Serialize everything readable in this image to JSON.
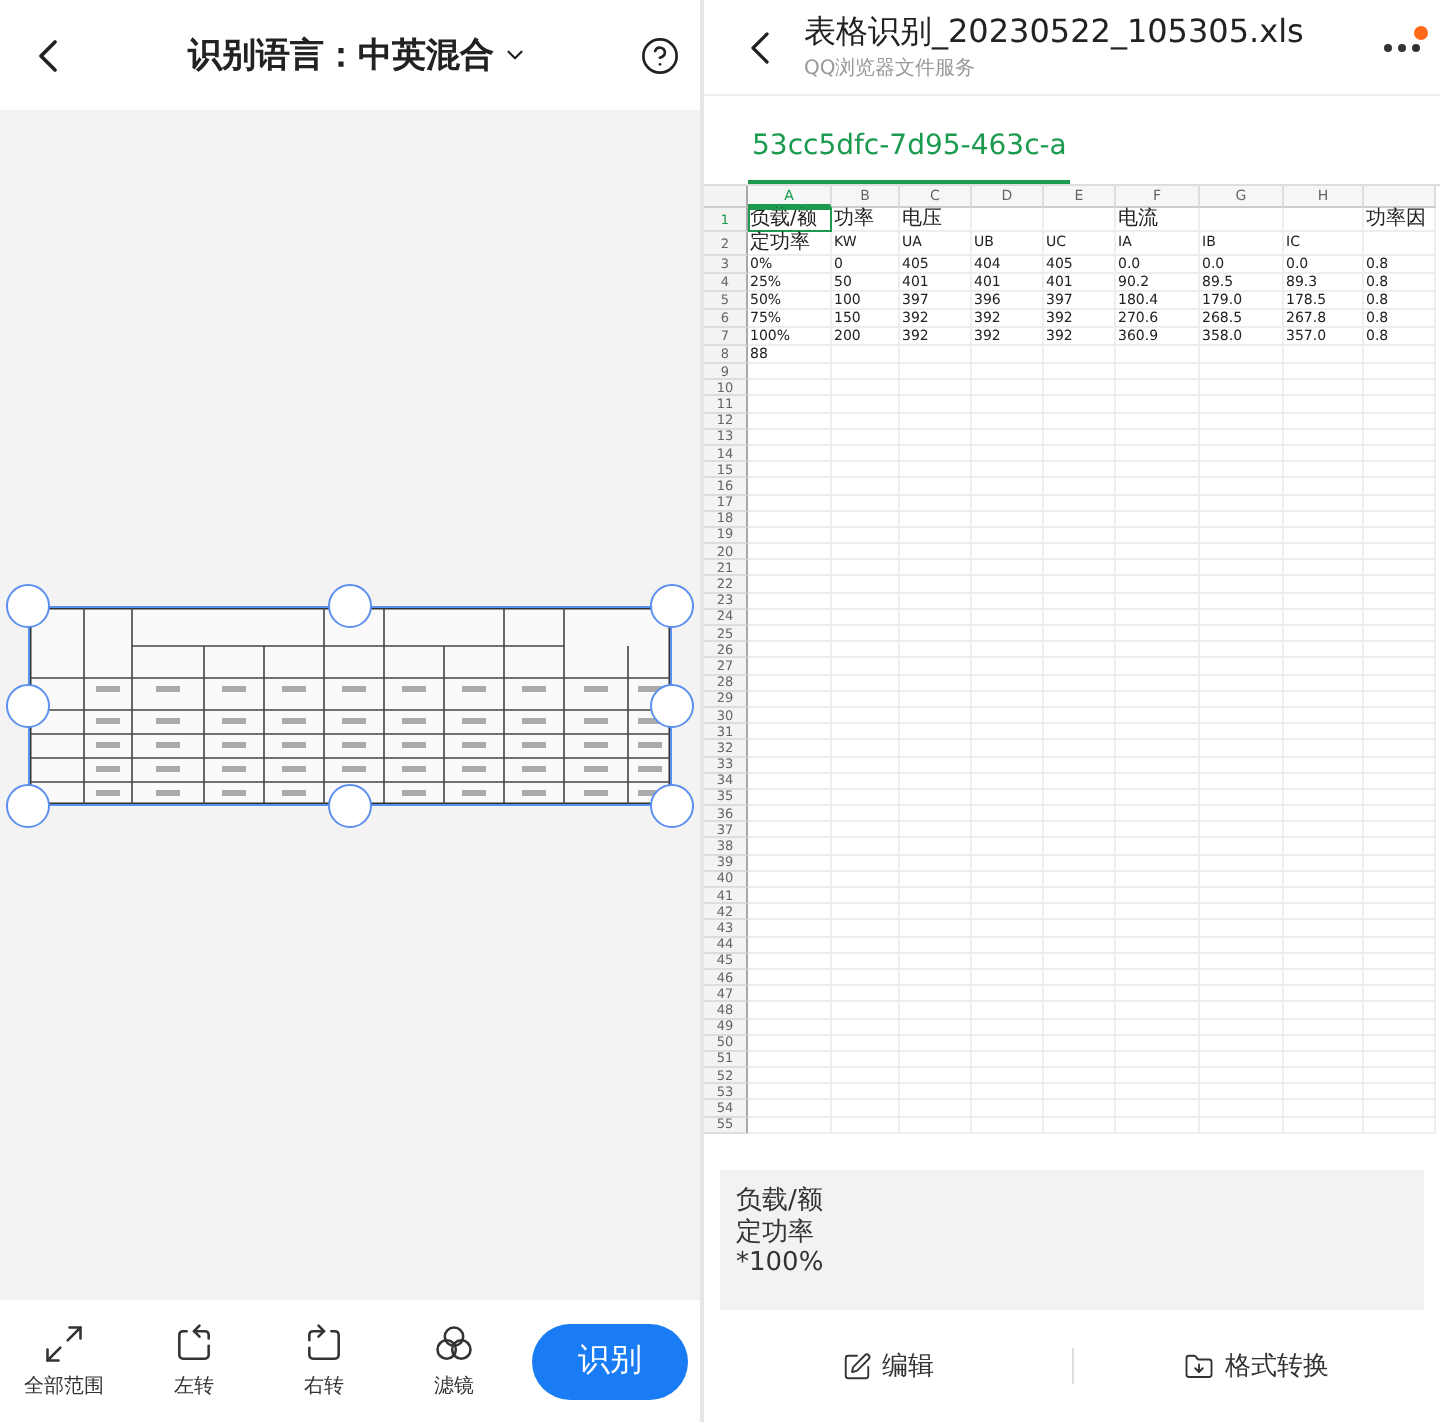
{
  "scan_screen": {
    "title": "识别语言：中英混合",
    "tools": [
      {
        "kind": "full",
        "label": "全部范围"
      },
      {
        "kind": "rotate_left",
        "label": "左转"
      },
      {
        "kind": "rotate_right",
        "label": "右转"
      },
      {
        "kind": "filter",
        "label": "滤镜"
      }
    ],
    "recognize_button": "识别"
  },
  "file_screen": {
    "title": "表格识别_20230522_105305.xls",
    "subtitle": "QQ浏览器文件服务",
    "has_notification": true,
    "sheet_tabs": [
      {
        "label": "53cc5dfc-7d95-463c-a",
        "selected": true
      }
    ],
    "sheet": {
      "columns": [
        {
          "label": "A",
          "selected": true
        },
        {
          "label": "B",
          "selected": false
        },
        {
          "label": "C",
          "selected": false
        },
        {
          "label": "D",
          "selected": false
        },
        {
          "label": "E",
          "selected": false
        },
        {
          "label": "F",
          "selected": false
        },
        {
          "label": "G",
          "selected": false
        },
        {
          "label": "H",
          "selected": false
        },
        {
          "selected": false
        }
      ],
      "rows": [
        {
          "number": "1",
          "selected": true,
          "cells": [
            "负载/额",
            "功率",
            "电压",
            null,
            null,
            "电流",
            null,
            null,
            "功率因"
          ]
        },
        {
          "number": "2",
          "selected": false,
          "cells": [
            "定功率",
            "KW",
            "UA",
            "UB",
            "UC",
            "IA",
            "IB",
            "IC",
            null
          ]
        },
        {
          "number": "3",
          "selected": false,
          "cells": [
            "0%",
            "0",
            "405",
            "404",
            "405",
            "0.0",
            "0.0",
            "0.0",
            "0.8"
          ]
        },
        {
          "number": "4",
          "selected": false,
          "cells": [
            "25%",
            "50",
            "401",
            "401",
            "401",
            "90.2",
            "89.5",
            "89.3",
            "0.8"
          ]
        },
        {
          "number": "5",
          "selected": false,
          "cells": [
            "50%",
            "100",
            "397",
            "396",
            "397",
            "180.4",
            "179.0",
            "178.5",
            "0.8"
          ]
        },
        {
          "number": "6",
          "selected": false,
          "cells": [
            "75%",
            "150",
            "392",
            "392",
            "392",
            "270.6",
            "268.5",
            "267.8",
            "0.8"
          ]
        },
        {
          "number": "7",
          "selected": false,
          "cells": [
            "100%",
            "200",
            "392",
            "392",
            "392",
            "360.9",
            "358.0",
            "357.0",
            "0.8"
          ]
        },
        {
          "number": "8",
          "selected": false,
          "cells": [
            "88",
            null,
            null,
            null,
            null,
            null,
            null,
            null,
            null
          ]
        }
      ],
      "empty_rows": [
        "9",
        "10",
        "11",
        "12",
        "13",
        "14",
        "15",
        "16",
        "17",
        "18",
        "19",
        "20",
        "21",
        "22",
        "23",
        "24",
        "25",
        "26",
        "27",
        "28",
        "29",
        "30",
        "31",
        "32",
        "33",
        "34",
        "35",
        "36",
        "37",
        "38",
        "39",
        "40",
        "41",
        "42",
        "43",
        "44",
        "45",
        "46",
        "47",
        "48",
        "49",
        "50",
        "51",
        "52",
        "53",
        "54",
        "55"
      ]
    },
    "cell_preview": [
      "负载/额",
      "定功率",
      "*100%"
    ],
    "actions": [
      {
        "kind": "edit",
        "label": "编辑"
      },
      {
        "kind": "convert",
        "label": "格式转换"
      }
    ]
  }
}
